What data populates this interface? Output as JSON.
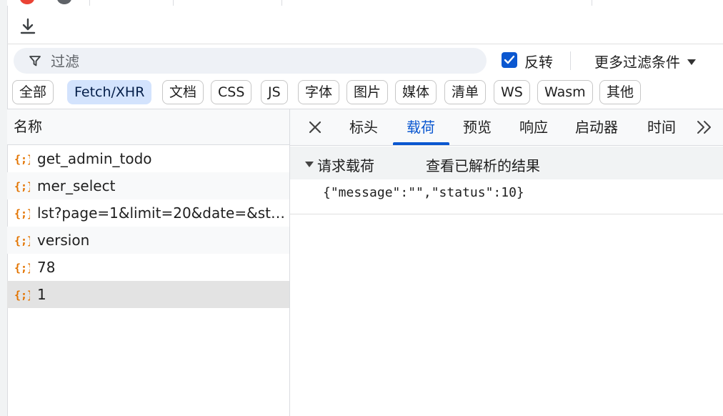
{
  "filter": {
    "placeholder": "过滤"
  },
  "invert": {
    "label": "反转",
    "checked": true
  },
  "more_filters": {
    "label": "更多过滤条件"
  },
  "types": [
    "全部",
    "Fetch/XHR",
    "文档",
    "CSS",
    "JS",
    "字体",
    "图片",
    "媒体",
    "清单",
    "WS",
    "Wasm",
    "其他"
  ],
  "active_type": "Fetch/XHR",
  "request_list": {
    "header": "名称",
    "rows": [
      {
        "name": "get_admin_todo"
      },
      {
        "name": "mer_select"
      },
      {
        "name": "lst?page=1&limit=20&date=&sta..."
      },
      {
        "name": "version"
      },
      {
        "name": "78"
      },
      {
        "name": "1",
        "selected": true
      }
    ]
  },
  "detail": {
    "tabs": [
      "标头",
      "载荷",
      "预览",
      "响应",
      "启动器",
      "时间"
    ],
    "active_tab": "载荷",
    "section_title": "请求载荷",
    "view_parsed": "查看已解析的结果",
    "payload": "{\"message\":\"\",\"status\":10}"
  },
  "colors": {
    "accent": "#0b57d0",
    "icon_orange": "#e37400"
  }
}
